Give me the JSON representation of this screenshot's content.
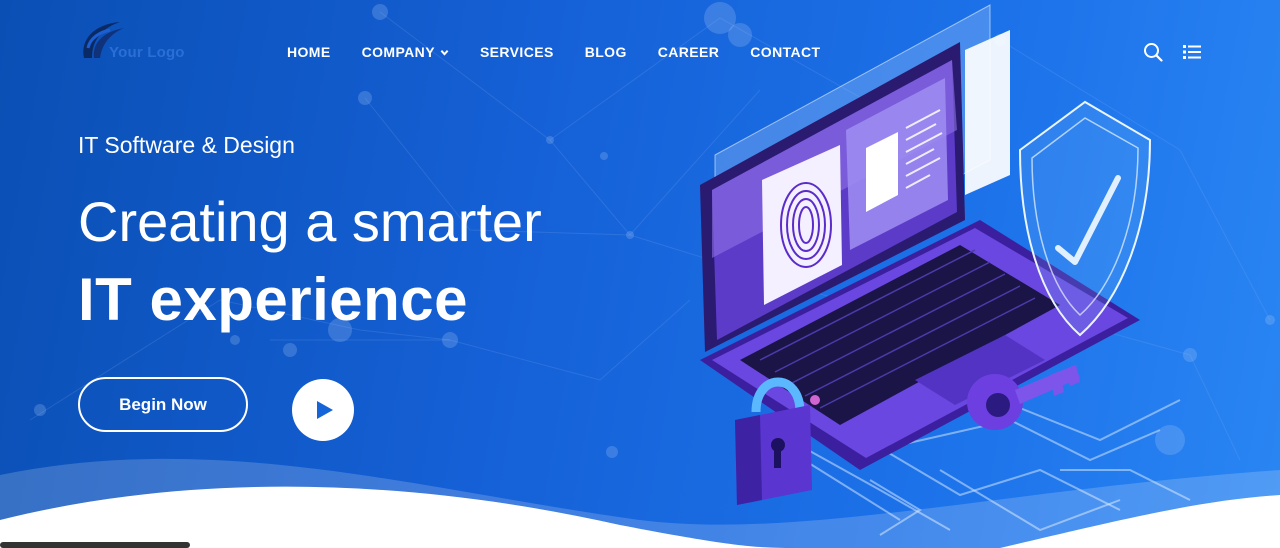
{
  "logo": {
    "text": "Your Logo",
    "icon": "logo-swoosh-icon"
  },
  "nav": {
    "items": [
      {
        "label": "HOME"
      },
      {
        "label": "COMPANY",
        "has_dropdown": true
      },
      {
        "label": "SERVICES"
      },
      {
        "label": "BLOG"
      },
      {
        "label": "CAREER"
      },
      {
        "label": "CONTACT"
      }
    ],
    "search_icon": "search-icon",
    "menu_icon": "menu-list-icon"
  },
  "hero": {
    "subtitle": "IT Software & Design",
    "headline_line1": "Creating a smarter",
    "headline_line2": "IT experience",
    "cta_label": "Begin Now",
    "play_icon": "play-icon"
  },
  "colors": {
    "background_start": "#0a4fb4",
    "background_end": "#2a86f3",
    "text": "#ffffff",
    "accent": "#1565d8",
    "logo_text": "#2a6fd6"
  }
}
